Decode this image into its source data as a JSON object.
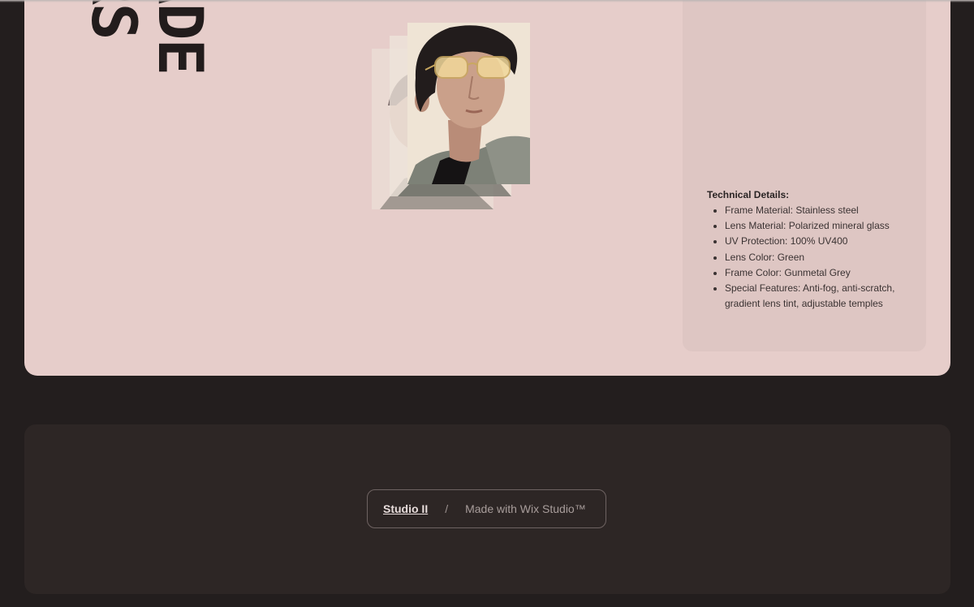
{
  "hero": {
    "title_line_1": "RS",
    "title_line_2": "ADE"
  },
  "gallery": {
    "portrait_alt": "Portrait of a man wearing gold-rimmed sunglasses"
  },
  "details": {
    "heading": "Technical Details:",
    "items": [
      "Frame Material: Stainless steel",
      "Lens Material: Polarized mineral glass",
      "UV Protection: 100% UV400",
      "Lens Color: Green",
      "Frame Color: Gunmetal Grey",
      "Special Features: Anti-fog, anti-scratch, gradient lens tint, adjustable temples"
    ]
  },
  "footer": {
    "studio_link": "Studio II",
    "separator": "/",
    "made_with": "Made with Wix Studio™"
  },
  "colors": {
    "page_background": "#231e1e",
    "card_background": "#e6cdca",
    "panel_background": "#dec6c3",
    "footer_background": "#2d2625"
  }
}
